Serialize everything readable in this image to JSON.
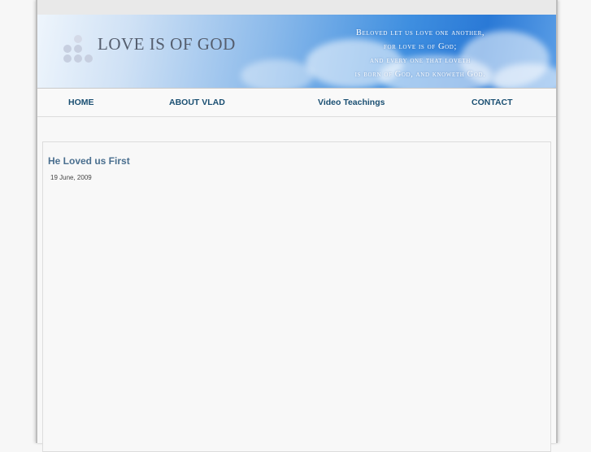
{
  "header": {
    "site_title": "LOVE IS OF GOD",
    "verse_lines": [
      "Beloved let us love one another,",
      "for love is of God;",
      "and every one that loveth",
      "is born of God, and knoweth God."
    ]
  },
  "nav": {
    "items": [
      {
        "label": "HOME"
      },
      {
        "label": "ABOUT VLAD"
      },
      {
        "label": "Video Teachings"
      },
      {
        "label": "CONTACT"
      }
    ]
  },
  "post": {
    "title": "He Loved us First",
    "date": "19 June, 2009"
  },
  "colors": {
    "nav_text": "#1a4f72",
    "title_text": "#4a6f8f",
    "banner_blue": "#2a79d6"
  }
}
